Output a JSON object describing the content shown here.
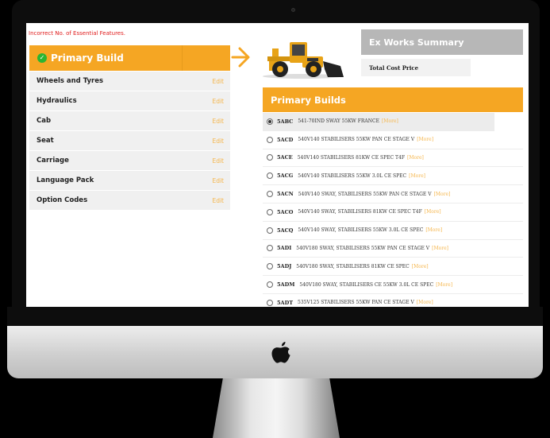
{
  "error": "Incorrect No. of Essential Features.",
  "primary_build": {
    "title": "Primary Build"
  },
  "menu": [
    {
      "label": "Wheels and Tyres",
      "action": "Edit"
    },
    {
      "label": "Hydraulics",
      "action": "Edit"
    },
    {
      "label": "Cab",
      "action": "Edit"
    },
    {
      "label": "Seat",
      "action": "Edit"
    },
    {
      "label": "Carriage",
      "action": "Edit"
    },
    {
      "label": "Language Pack",
      "action": "Edit"
    },
    {
      "label": "Option Codes",
      "action": "Edit"
    }
  ],
  "summary": {
    "title": "Ex Works Summary",
    "total_label": "Total Cost Price",
    "total_value": ""
  },
  "builds": {
    "title": "Primary Builds",
    "more_label": "[More]",
    "items": [
      {
        "code": "5ABC",
        "desc": "541-70IND SWAY 55KW FRANCE",
        "selected": true
      },
      {
        "code": "5ACD",
        "desc": "540V140 STABILISERS 55KW PAN CE STAGE V",
        "selected": false
      },
      {
        "code": "5ACE",
        "desc": "540V140 STABILISERS 81KW CE SPEC T4F",
        "selected": false
      },
      {
        "code": "5ACG",
        "desc": "540V140 STABILISERS 55KW 3.0L CE SPEC",
        "selected": false
      },
      {
        "code": "5ACN",
        "desc": "540V140 SWAY, STABILISERS 55KW PAN CE STAGE V",
        "selected": false
      },
      {
        "code": "5ACO",
        "desc": "540V140 SWAY, STABILISERS 81KW CE SPEC T4F",
        "selected": false
      },
      {
        "code": "5ACQ",
        "desc": "540V140 SWAY, STABILISERS 55KW 3.0L CE SPEC",
        "selected": false
      },
      {
        "code": "5ADI",
        "desc": "540V180 SWAY, STABILISERS 55KW PAN CE STAGE V",
        "selected": false
      },
      {
        "code": "5ADJ",
        "desc": "540V180 SWAY, STABILISERS 81KW CE SPEC",
        "selected": false
      },
      {
        "code": "5ADM",
        "desc": "540V180 SWAY, STABILISERS CE 55KW 3.0L CE SPEC",
        "selected": false
      },
      {
        "code": "5ADT",
        "desc": "535V125 STABILISERS 55KW PAN CE STAGE V",
        "selected": false
      }
    ]
  },
  "colors": {
    "accent": "#f5a623",
    "error": "#e01b1b",
    "check": "#2bb532",
    "summary_head": "#b7b7b7"
  }
}
